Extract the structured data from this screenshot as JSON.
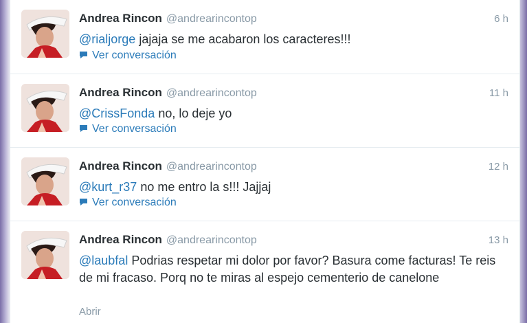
{
  "tweets": [
    {
      "name": "Andrea Rincon",
      "handle": "@andrearincontop",
      "time": "6 h",
      "mention": "@rialjorge",
      "text": " jajaja se me acabaron los caracteres!!!",
      "action": "Ver conversación",
      "action_icon": "speech-bubble-icon"
    },
    {
      "name": "Andrea Rincon",
      "handle": "@andrearincontop",
      "time": "11 h",
      "mention": "@CrissFonda",
      "text": " no, lo deje yo",
      "action": "Ver conversación",
      "action_icon": "speech-bubble-icon"
    },
    {
      "name": "Andrea Rincon",
      "handle": "@andrearincontop",
      "time": "12 h",
      "mention": "@kurt_r37",
      "text": " no me entro la s!!! Jajjaj",
      "action": "Ver conversación",
      "action_icon": "speech-bubble-icon"
    },
    {
      "name": "Andrea Rincon",
      "handle": "@andrearincontop",
      "time": "13 h",
      "mention": "@laubfal",
      "text": " Podrias respetar mi dolor por favor? Basura come facturas! Te reis de mi fracaso. Porq no te miras al espejo cementerio de canelone",
      "action": "Abrir"
    }
  ],
  "colors": {
    "link": "#2b7bb9",
    "muted": "#8899a6",
    "text": "#292f33"
  }
}
